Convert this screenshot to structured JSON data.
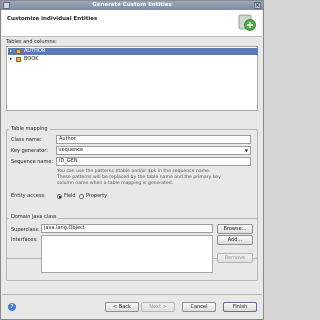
{
  "window": {
    "title": "Generate Custom Entities"
  },
  "header": {
    "title": "Customize individual Entities"
  },
  "tables": {
    "label": "Tables and columns:",
    "items": [
      {
        "label": "AUTHOR",
        "selected": true
      },
      {
        "label": "BOOK",
        "selected": false
      }
    ]
  },
  "mapping": {
    "group_label": "Table mapping",
    "class_name_label": "Class name:",
    "class_name_value": "Author",
    "key_generator_label": "Key generator:",
    "key_generator_value": "sequence",
    "sequence_label": "Sequence name:",
    "sequence_value": "ID_GEN",
    "help_line1": "You can use the patterns $table and/or $pk in the sequence name.",
    "help_line2": "These patterns will be replaced by the table name and the primary key",
    "help_line3": "column name when a table mapping is generated.",
    "entity_access_label": "Entity access:",
    "access_field": "Field",
    "access_property": "Property"
  },
  "domain": {
    "group_label": "Domain java class",
    "superclass_label": "Superclass:",
    "superclass_value": "java.lang.Object",
    "browse_label": "Browse...",
    "interfaces_label": "Interfaces:",
    "add_label": "Add...",
    "remove_label": "Remove"
  },
  "footer": {
    "help_symbol": "?",
    "back_label": "< Back",
    "next_label": "Next >",
    "cancel_label": "Cancel",
    "finish_label": "Finish"
  }
}
